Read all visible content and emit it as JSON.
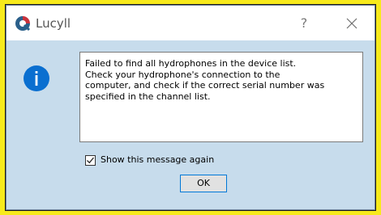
{
  "window": {
    "title": "Lucyll",
    "help_glyph": "?",
    "close_icon": "close-icon",
    "logo_icon": "lucyll-logo-icon"
  },
  "dialog": {
    "icon": "info-icon",
    "message": "Failed to find all hydrophones in the device list.\nCheck your hydrophone's connection to the\ncomputer, and check if the correct serial number was\nspecified in the channel list.",
    "checkbox_label": "Show this message again",
    "checkbox_checked": true,
    "ok_label": "OK"
  },
  "colors": {
    "highlight_frame": "#f7ea1c",
    "dialog_background": "#c7dcec",
    "info_icon": "#0a6fd0",
    "default_button_border": "#0078d7"
  }
}
